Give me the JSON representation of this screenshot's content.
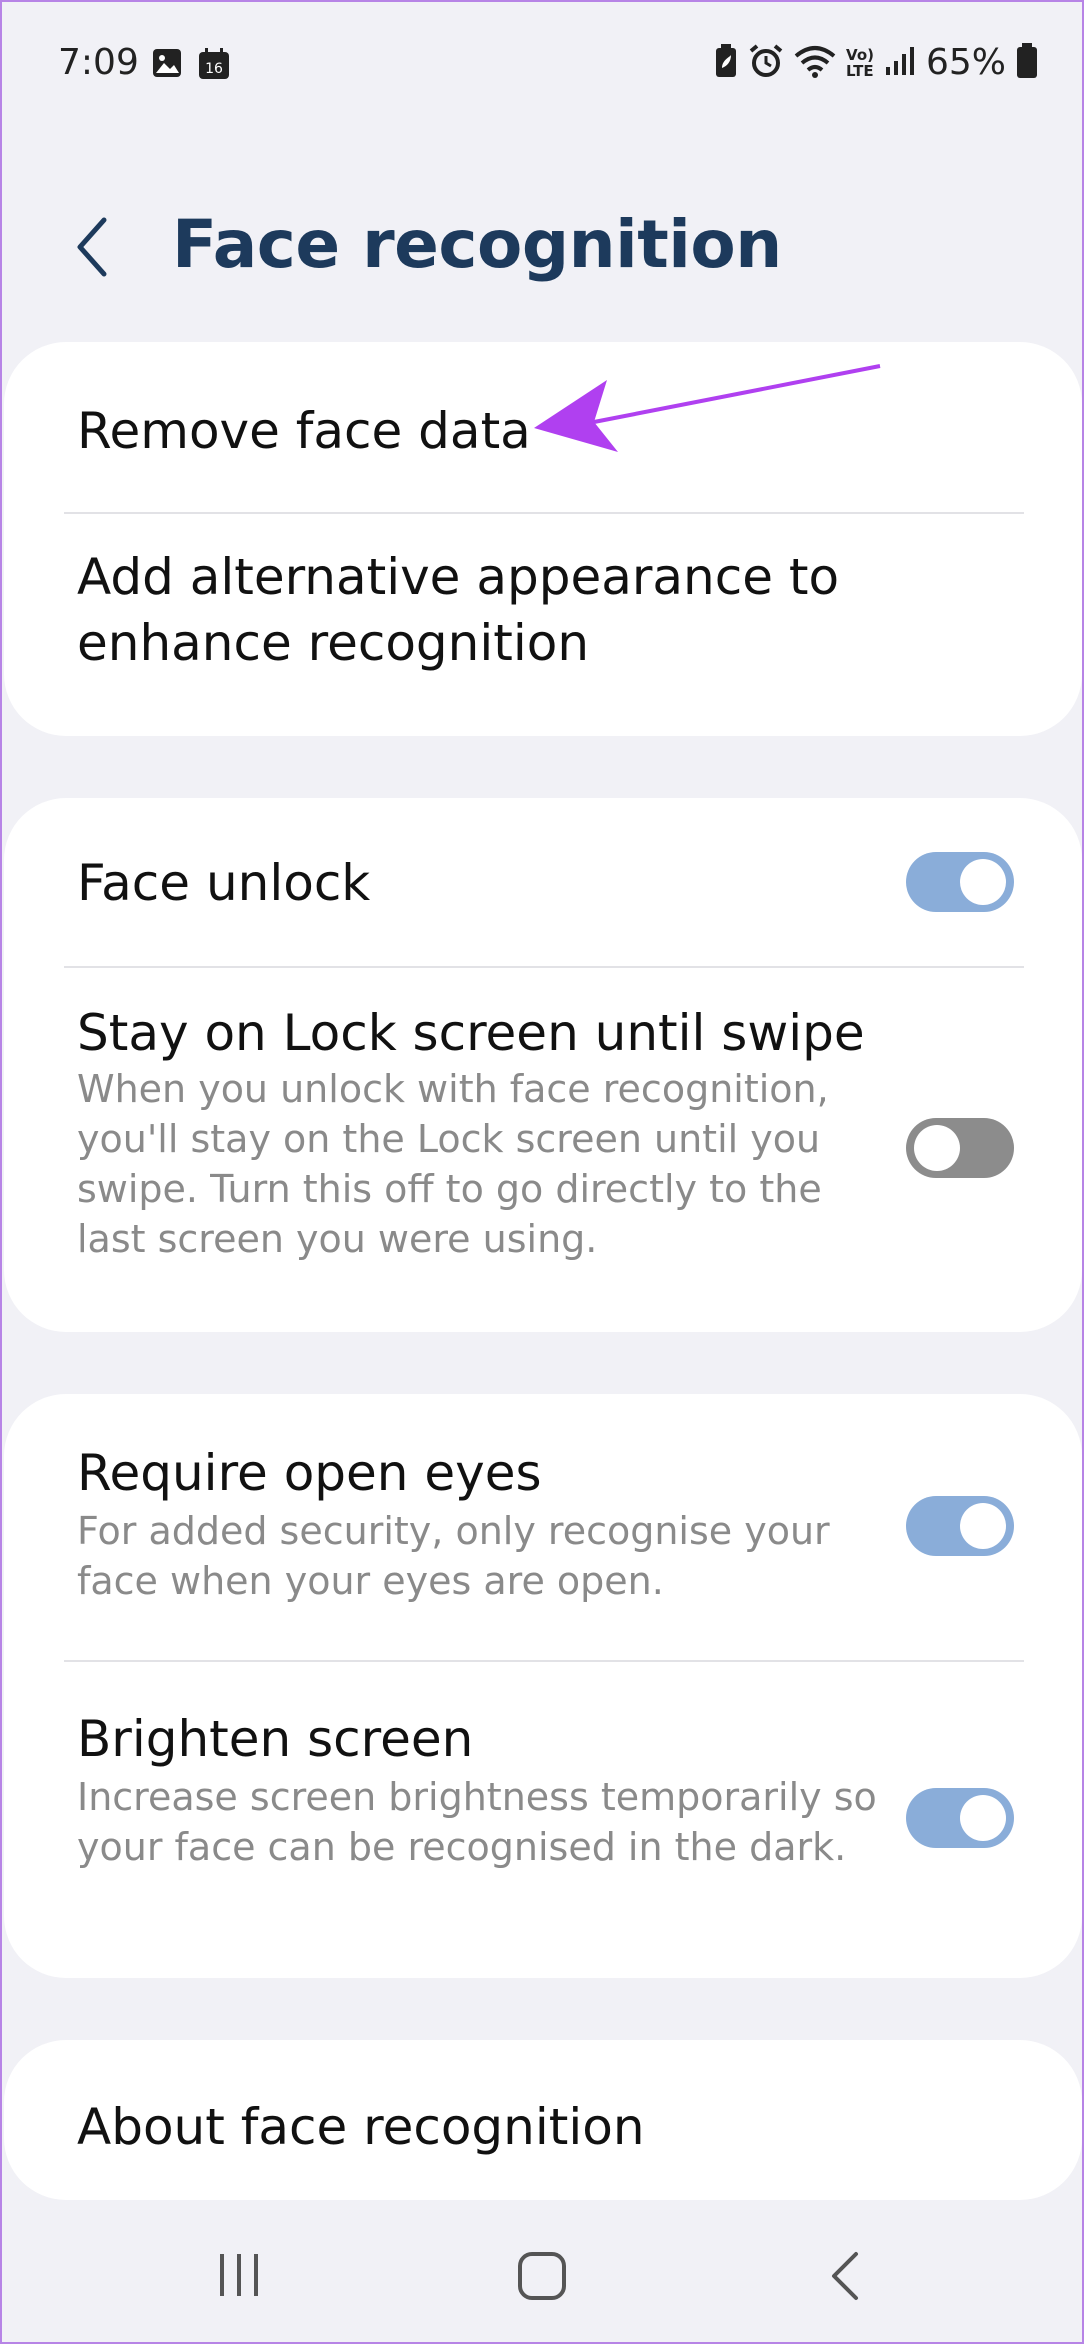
{
  "status": {
    "time": "7:09",
    "battery_pct": "65%",
    "calendar_day": "16",
    "network_label_top": "Vo)",
    "network_label_bottom": "LTE"
  },
  "header": {
    "title": "Face recognition"
  },
  "items": {
    "remove_face_data": "Remove face data",
    "add_alt_appearance": "Add alternative appearance to enhance recognition",
    "face_unlock": "Face unlock",
    "stay_on_lock": "Stay on Lock screen until swipe",
    "stay_on_lock_desc": "When you unlock with face recognition, you'll stay on the Lock screen until you swipe. Turn this off to go directly to the last screen you were using.",
    "require_open_eyes": "Require open eyes",
    "require_open_eyes_desc": "For added security, only recognise your face when your eyes are open.",
    "brighten_screen": "Brighten screen",
    "brighten_screen_desc": "Increase screen brightness temporarily so your face can be recognised in the dark.",
    "about": "About face recognition"
  },
  "toggles": {
    "face_unlock": true,
    "stay_on_lock": false,
    "require_open_eyes": true,
    "brighten_screen": true
  },
  "colors": {
    "title": "#1d3a5c",
    "toggle_on": "#8aadd9",
    "toggle_off": "#8c8c8c",
    "annotation_arrow": "#b040f0",
    "background": "#f1f1f6"
  }
}
